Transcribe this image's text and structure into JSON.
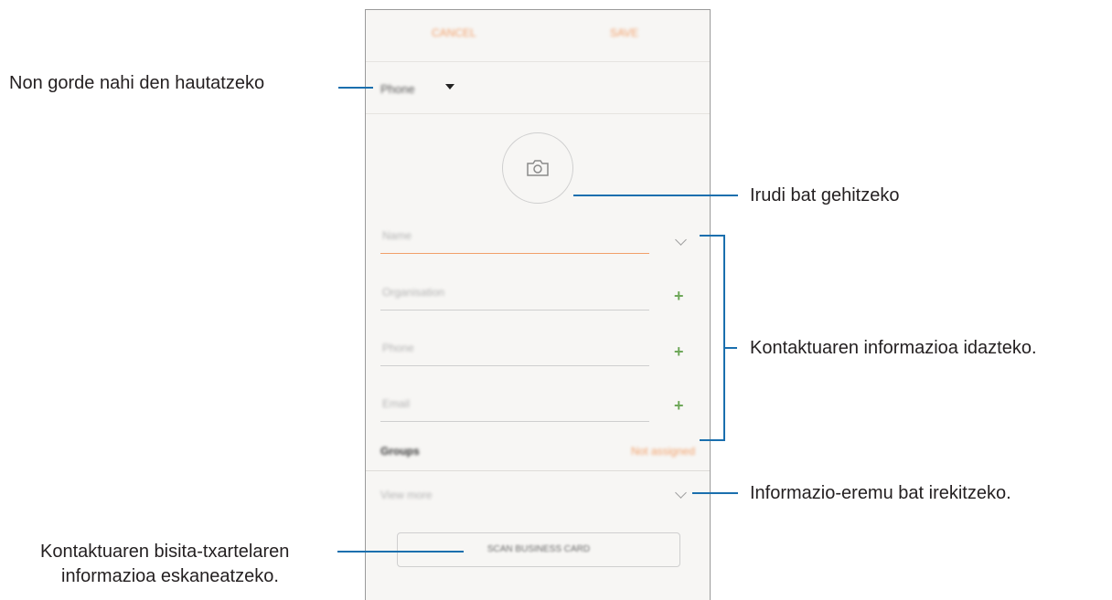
{
  "topbar": {
    "cancel_label": "CANCEL",
    "save_label": "SAVE"
  },
  "save_location": {
    "label": "Phone"
  },
  "fields": {
    "name": "Name",
    "organisation": "Organisation",
    "phone": "Phone",
    "email": "Email"
  },
  "groups": {
    "label": "Groups",
    "value": "Not assigned"
  },
  "view_more": "View more",
  "scan_button": "SCAN BUSINESS CARD",
  "annotations": {
    "save_location": "Non gorde nahi den hautatzeko",
    "add_image": "Irudi bat gehitzeko",
    "enter_info": "Kontaktuaren informazioa idazteko.",
    "open_field": "Informazio-eremu bat irekitzeko.",
    "scan_line1": "Kontaktuaren bisita-txartelaren",
    "scan_line2": "informazioa eskaneatzeko."
  },
  "colors": {
    "accent": "#f2a06a",
    "plus": "#6fa85a",
    "callout": "#1a6fae"
  },
  "icons": [
    "camera-icon",
    "chevron-down-icon",
    "plus-icon",
    "caret-down-icon"
  ]
}
